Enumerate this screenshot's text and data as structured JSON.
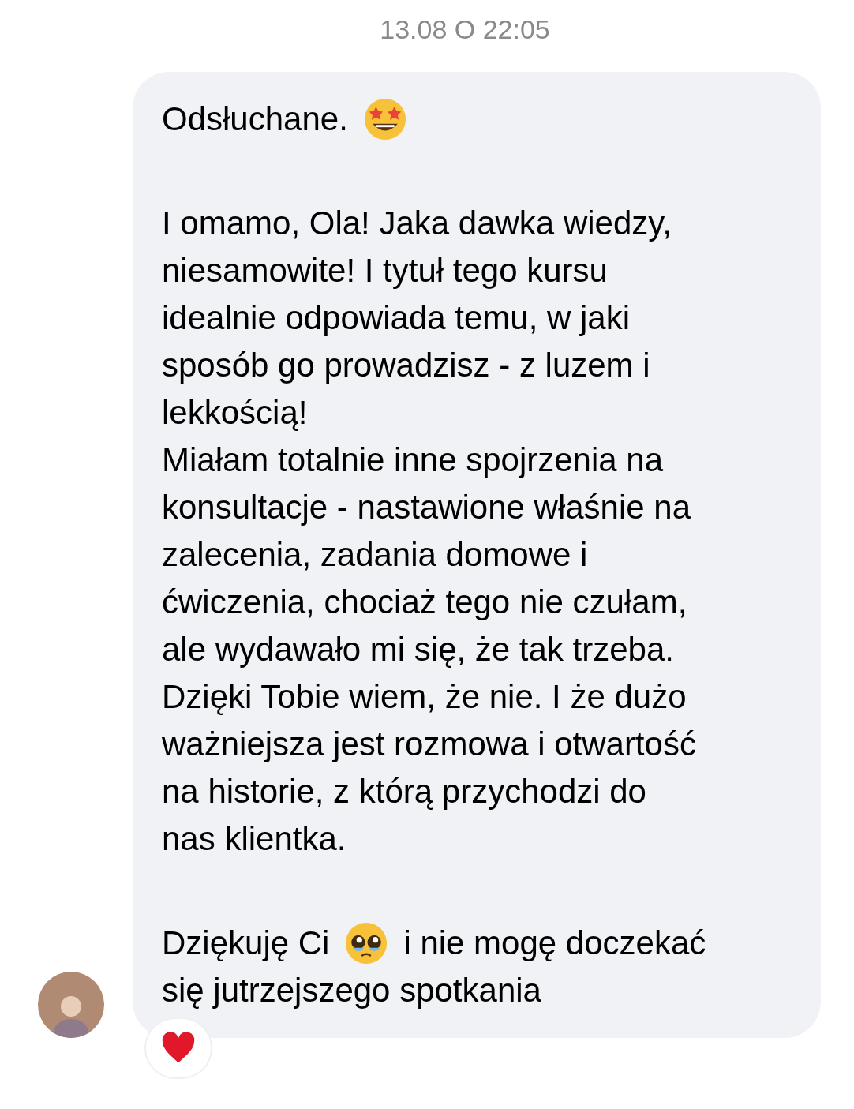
{
  "timestamp": "13.08 O 22:05",
  "message": {
    "paragraphs": [
      {
        "lines": [
          [
            {
              "kind": "text",
              "text": "Odsłuchane."
            },
            {
              "kind": "star-eyes-emoji"
            }
          ]
        ]
      },
      {
        "lines": [
          [
            {
              "kind": "text",
              "text": "I omamo, Ola! Jaka dawka wiedzy,"
            }
          ],
          [
            {
              "kind": "text",
              "text": "niesamowite! I tytuł tego kursu"
            }
          ],
          [
            {
              "kind": "text",
              "text": "idealnie odpowiada temu, w jaki"
            }
          ],
          [
            {
              "kind": "text",
              "text": "sposób go prowadzisz - z luzem i"
            }
          ],
          [
            {
              "kind": "text",
              "text": "lekkością!"
            }
          ],
          [
            {
              "kind": "text",
              "text": "Miałam totalnie inne spojrzenia na"
            }
          ],
          [
            {
              "kind": "text",
              "text": "konsultacje - nastawione właśnie na"
            }
          ],
          [
            {
              "kind": "text",
              "text": "zalecenia, zadania domowe i"
            }
          ],
          [
            {
              "kind": "text",
              "text": "ćwiczenia, chociaż tego nie czułam,"
            }
          ],
          [
            {
              "kind": "text",
              "text": "ale wydawało mi się, że tak trzeba."
            }
          ],
          [
            {
              "kind": "text",
              "text": "Dzięki Tobie wiem, że nie. I że dużo"
            }
          ],
          [
            {
              "kind": "text",
              "text": "ważniejsza jest rozmowa i otwartość"
            }
          ],
          [
            {
              "kind": "text",
              "text": "na historie, z którą przychodzi do"
            }
          ],
          [
            {
              "kind": "text",
              "text": "nas klientka."
            }
          ]
        ]
      },
      {
        "lines": [
          [
            {
              "kind": "text",
              "text": "Dziękuję Ci"
            },
            {
              "kind": "pleading-emoji"
            },
            {
              "kind": "text",
              "text": "i nie mogę doczekać"
            }
          ],
          [
            {
              "kind": "text",
              "text": "się jutrzejszego spotkania"
            }
          ]
        ]
      }
    ]
  },
  "reaction": {
    "kind": "heart"
  }
}
